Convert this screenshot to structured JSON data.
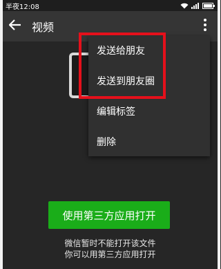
{
  "status": {
    "time": "半夜12:08",
    "battery_color": "#ffffff"
  },
  "header": {
    "title": "视频",
    "back_icon": "arrow-left-icon",
    "more_icon": "more-vertical-icon"
  },
  "menu": {
    "items": [
      {
        "label": "发送给朋友"
      },
      {
        "label": "发送到朋友圈"
      },
      {
        "label": "编辑标签"
      },
      {
        "label": "删除"
      }
    ],
    "highlight_color": "#e5101b"
  },
  "main": {
    "open_button_label": "使用第三方应用打开",
    "notice_line1": "微信暂时不能打开该文件",
    "notice_line2": "你可以用第三方应用打开",
    "accent_color": "#1aad19"
  }
}
